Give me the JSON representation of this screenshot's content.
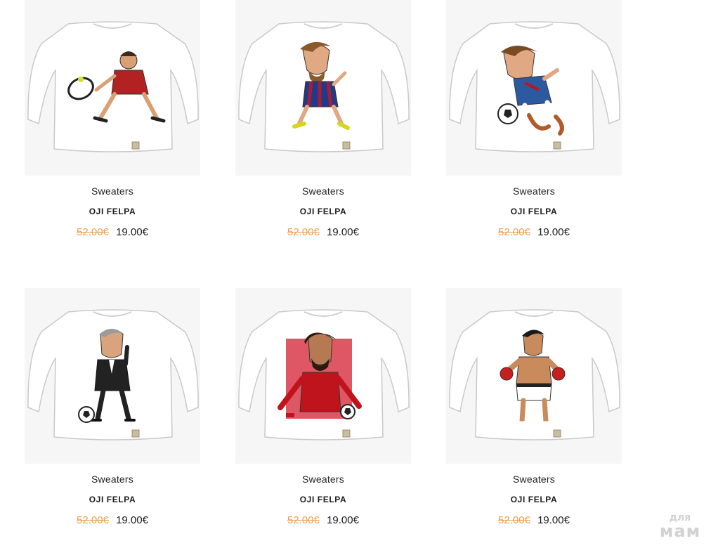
{
  "products": [
    {
      "category": "Sweaters",
      "title": "OJI FELPA",
      "old_price": "52.00€",
      "new_price": "19.00€",
      "illustration": "tennis-player-icon",
      "accent": "#b22222"
    },
    {
      "category": "Sweaters",
      "title": "OJI FELPA",
      "old_price": "52.00€",
      "new_price": "19.00€",
      "illustration": "striped-footballer-icon",
      "accent": "#1f3a8a"
    },
    {
      "category": "Sweaters",
      "title": "OJI FELPA",
      "old_price": "52.00€",
      "new_price": "19.00€",
      "illustration": "blue-footballer-icon",
      "accent": "#2c5aa0"
    },
    {
      "category": "Sweaters",
      "title": "OJI FELPA",
      "old_price": "52.00€",
      "new_price": "19.00€",
      "illustration": "suited-coach-icon",
      "accent": "#222222"
    },
    {
      "category": "Sweaters",
      "title": "OJI FELPA",
      "old_price": "52.00€",
      "new_price": "19.00€",
      "illustration": "red-footballer-icon",
      "accent": "#c0141c"
    },
    {
      "category": "Sweaters",
      "title": "OJI FELPA",
      "old_price": "52.00€",
      "new_price": "19.00€",
      "illustration": "boxer-icon",
      "accent": "#c81e1e"
    }
  ],
  "watermark": {
    "top": "для",
    "bottom": "мам"
  },
  "colors": {
    "old_price": "#e8a253",
    "new_price": "#1a1a1a",
    "image_bg": "#f6f6f6"
  }
}
